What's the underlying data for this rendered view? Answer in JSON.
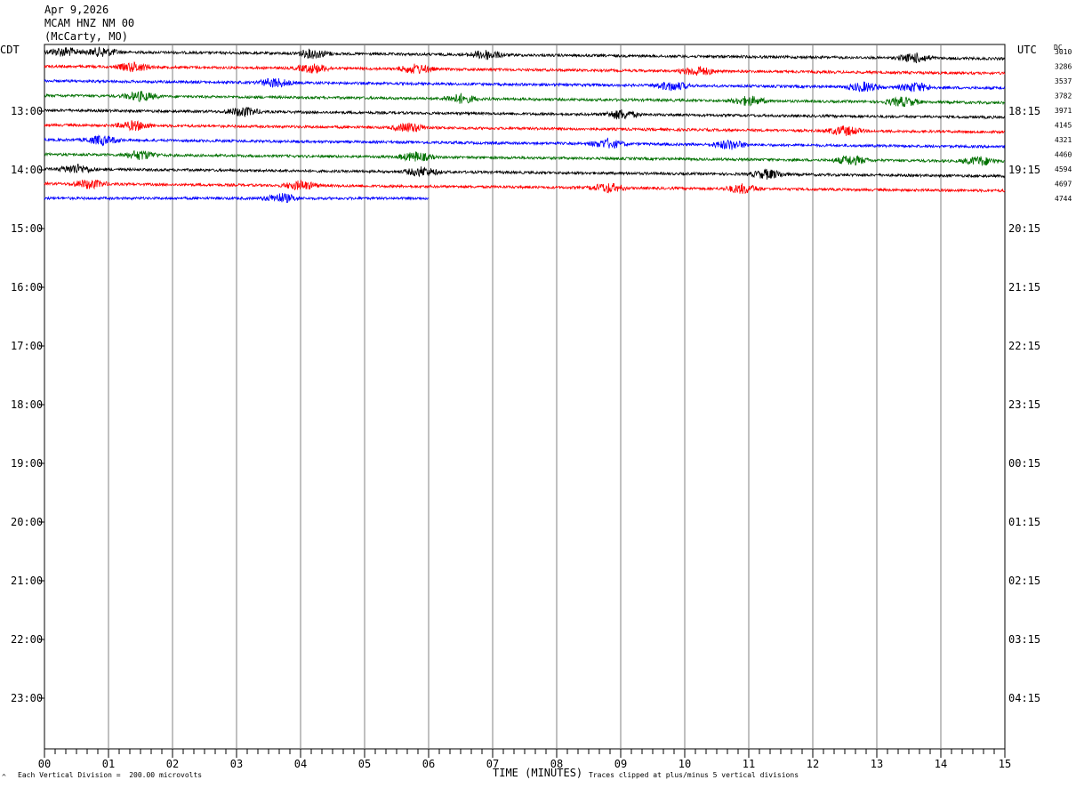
{
  "header": {
    "date": "Apr 9,2026",
    "station": "MCAM HNZ NM 00",
    "location": "(McCarty, MO)"
  },
  "left_timezone": "CDT",
  "right_timezone": "UTC",
  "dc_label": "DC",
  "footer": {
    "scale_note": "Each Vertical Division =  200.00 microvolts",
    "clip_note": "Traces clipped at plus/minus 5 vertical divisions",
    "xlabel": "TIME (MINUTES)",
    "corner_mark": "^"
  },
  "chart_data": {
    "type": "line",
    "xlabel": "TIME (MINUTES)",
    "xlim": [
      0,
      15
    ],
    "x_ticks": [
      "00",
      "01",
      "02",
      "03",
      "04",
      "05",
      "06",
      "07",
      "08",
      "09",
      "10",
      "11",
      "12",
      "13",
      "14",
      "15"
    ],
    "left_hour_labels": [
      "13:00",
      "14:00",
      "15:00",
      "16:00",
      "17:00",
      "18:00",
      "19:00",
      "20:00",
      "21:00",
      "22:00",
      "23:00"
    ],
    "right_hour_labels": [
      "18:15",
      "19:15",
      "20:15",
      "21:15",
      "22:15",
      "23:15",
      "00:15",
      "01:15",
      "02:15",
      "03:15",
      "04:15"
    ],
    "trace_colors": [
      "#000000",
      "#ff0000",
      "#0000ff",
      "#007000"
    ],
    "dc_offsets": [
      "3010",
      "3286",
      "3537",
      "3782",
      "3971",
      "4145",
      "4321",
      "4460",
      "4594",
      "4697",
      "4744"
    ],
    "traces_plotted": 11,
    "last_trace_end_minute": 6.0,
    "grid": true
  }
}
